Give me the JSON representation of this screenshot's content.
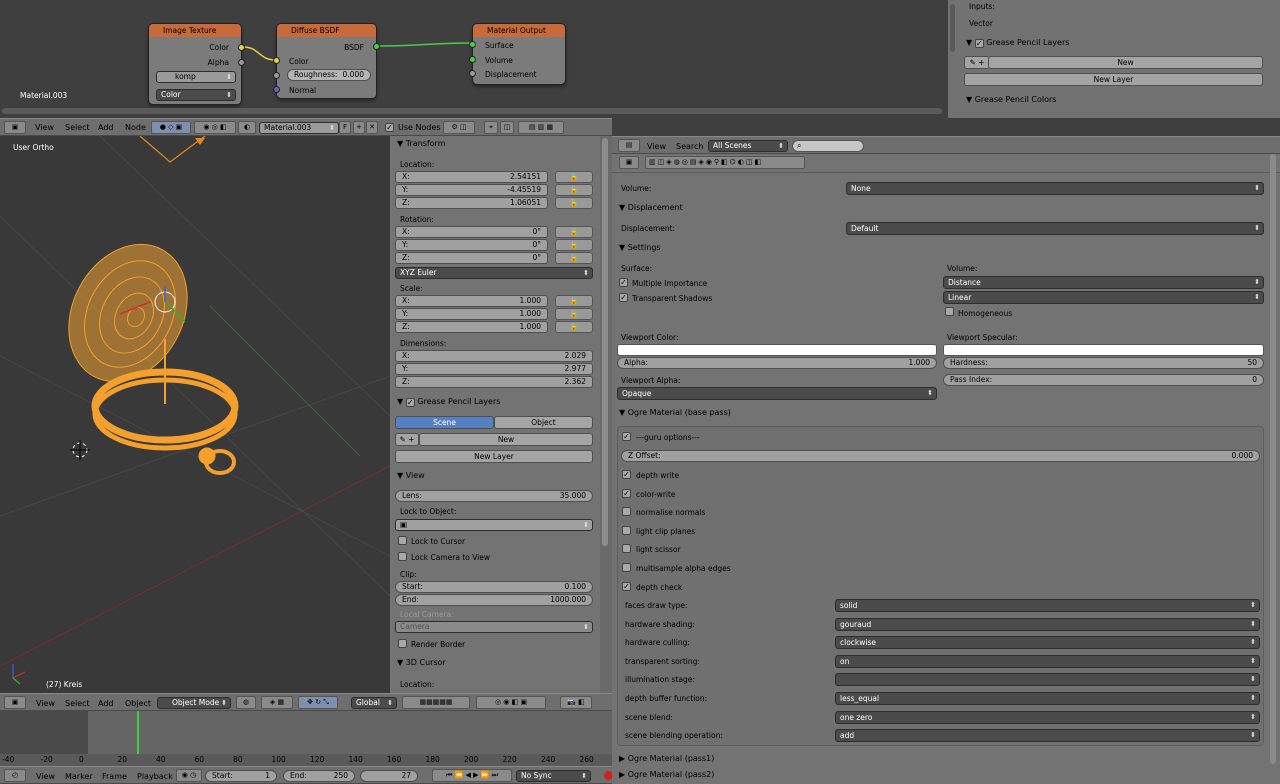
{
  "node_editor": {
    "material_label": "Material.003",
    "image_texture": {
      "title": "Image Texture",
      "out_color": "Color",
      "out_alpha": "Alpha",
      "image_name": "komp",
      "flag": "F",
      "color_select": "Color"
    },
    "diffuse": {
      "title": "Diffuse BSDF",
      "out": "BSDF",
      "in_color": "Color",
      "roughness_label": "Roughness:",
      "roughness_value": "0.000",
      "in_normal": "Normal"
    },
    "output": {
      "title": "Material Output",
      "surface": "Surface",
      "volume": "Volume",
      "displacement": "Displacement"
    },
    "header": {
      "view": "View",
      "select": "Select",
      "add": "Add",
      "node": "Node",
      "material": "Material.003",
      "flag": "F",
      "use_nodes": "Use Nodes"
    }
  },
  "top_right": {
    "inputs": "Inputs:",
    "vector": "Vector",
    "gp_layers": "Grease Pencil Layers",
    "new": "New",
    "new_layer": "New Layer",
    "gp_colors": "Grease Pencil Colors"
  },
  "viewport": {
    "label": "User Ortho",
    "object_label": "(27) Kreis",
    "colors": {
      "wire": "#f5a02c",
      "grid": "#555555"
    }
  },
  "viewport_header": {
    "view": "View",
    "select": "Select",
    "add": "Add",
    "object": "Object",
    "mode": "Object Mode",
    "orientation": "Global"
  },
  "npanel": {
    "transform": "Transform",
    "location_label": "Location:",
    "location": [
      {
        "axis": "X:",
        "value": "2.54151"
      },
      {
        "axis": "Y:",
        "value": "-4.45519"
      },
      {
        "axis": "Z:",
        "value": "1.06051"
      }
    ],
    "rotation_label": "Rotation:",
    "rotation": [
      {
        "axis": "X:",
        "value": "0°"
      },
      {
        "axis": "Y:",
        "value": "0°"
      },
      {
        "axis": "Z:",
        "value": "0°"
      }
    ],
    "rotation_mode": "XYZ Euler",
    "scale_label": "Scale:",
    "scale": [
      {
        "axis": "X:",
        "value": "1.000"
      },
      {
        "axis": "Y:",
        "value": "1.000"
      },
      {
        "axis": "Z:",
        "value": "1.000"
      }
    ],
    "dimensions_label": "Dimensions:",
    "dimensions": [
      {
        "axis": "X:",
        "value": "2.029"
      },
      {
        "axis": "Y:",
        "value": "2.977"
      },
      {
        "axis": "Z:",
        "value": "2.362"
      }
    ],
    "gp_layers": "Grease Pencil Layers",
    "scene": "Scene",
    "object": "Object",
    "new": "New",
    "new_layer": "New Layer",
    "view": "View",
    "lens_label": "Lens:",
    "lens_value": "35.000",
    "lock_to_object": "Lock to Object:",
    "lock_to_cursor": "Lock to Cursor",
    "lock_camera": "Lock Camera to View",
    "clip": "Clip:",
    "start_label": "Start:",
    "start_value": "0.100",
    "end_label": "End:",
    "end_value": "1000.000",
    "local_camera": "Local Camera:",
    "camera": "Camera",
    "render_border": "Render Border",
    "cursor_3d": "3D Cursor",
    "cursor_location": "Location:"
  },
  "timeline": {
    "ticks": [
      "-40",
      "-20",
      "0",
      "20",
      "40",
      "60",
      "80",
      "100",
      "120",
      "140",
      "160",
      "180",
      "200",
      "220",
      "240",
      "260"
    ],
    "view": "View",
    "marker": "Marker",
    "frame": "Frame",
    "playback": "Playback",
    "start_label": "Start:",
    "start_value": "1",
    "end_label": "End:",
    "end_value": "250",
    "current": "27",
    "sync": "No Sync"
  },
  "properties": {
    "header": {
      "view": "View",
      "search": "Search",
      "scenes": "All Scenes"
    },
    "volume_label": "Volume:",
    "volume_value": "None",
    "displacement": "Displacement",
    "displacement_label": "Displacement:",
    "displacement_value": "Default",
    "settings": "Settings",
    "surface": "Surface:",
    "multiple_importance": "Multiple Importance",
    "transparent_shadows": "Transparent Shadows",
    "volume2": "Volume:",
    "distance": "Distance",
    "linear": "Linear",
    "homogeneous": "Homogeneous",
    "viewport_color": "Viewport Color:",
    "viewport_specular": "Viewport Specular:",
    "alpha_label": "Alpha:",
    "alpha_value": "1.000",
    "hardness_label": "Hardness:",
    "hardness_value": "50",
    "viewport_alpha": "Viewport Alpha:",
    "opaque": "Opaque",
    "pass_index_label": "Pass Index:",
    "pass_index_value": "0",
    "ogre": "Ogre Material (base pass)",
    "guru": "---guru options---",
    "z_offset_label": "Z Offset:",
    "z_offset_value": "0.000",
    "checks": [
      {
        "label": "depth write",
        "on": true
      },
      {
        "label": "color-write",
        "on": true
      },
      {
        "label": "normalise normals",
        "on": false
      },
      {
        "label": "light clip planes",
        "on": false
      },
      {
        "label": "light scissor",
        "on": false
      },
      {
        "label": "multisample alpha edges",
        "on": false
      },
      {
        "label": "depth check",
        "on": true
      }
    ],
    "options": [
      {
        "label": "faces draw type:",
        "value": "solid"
      },
      {
        "label": "hardware shading:",
        "value": "gouraud"
      },
      {
        "label": "hardware culling:",
        "value": "clockwise"
      },
      {
        "label": "transparent sorting:",
        "value": "on"
      },
      {
        "label": "illumination stage:",
        "value": ""
      },
      {
        "label": "depth buffer function:",
        "value": "less_equal"
      },
      {
        "label": "scene blend:",
        "value": "one zero"
      },
      {
        "label": "scene blending operation:",
        "value": "add"
      }
    ],
    "pass1": "Ogre Material (pass1)",
    "pass2": "Ogre Material (pass2)"
  }
}
